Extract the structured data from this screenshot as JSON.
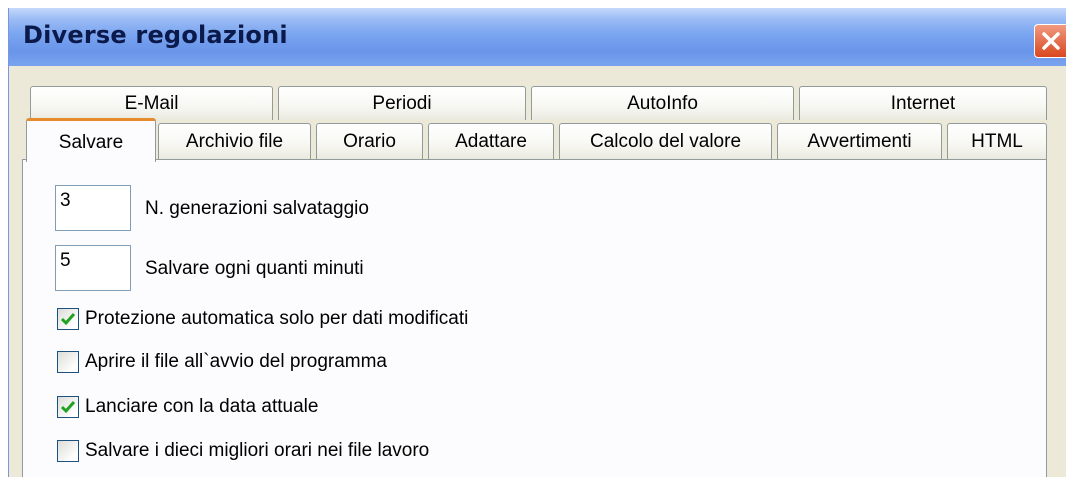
{
  "window": {
    "title": "Diverse regolazioni"
  },
  "tabs": {
    "row1": [
      {
        "id": "email",
        "label": "E-Mail"
      },
      {
        "id": "periodi",
        "label": "Periodi"
      },
      {
        "id": "autoinfo",
        "label": "AutoInfo"
      },
      {
        "id": "internet",
        "label": "Internet"
      }
    ],
    "row2": [
      {
        "id": "salvare",
        "label": "Salvare",
        "active": true
      },
      {
        "id": "archivio-file",
        "label": "Archivio file"
      },
      {
        "id": "orario",
        "label": "Orario"
      },
      {
        "id": "adattare",
        "label": "Adattare"
      },
      {
        "id": "calcolo-del-valore",
        "label": "Calcolo del valore"
      },
      {
        "id": "avvertimenti",
        "label": "Avvertimenti"
      },
      {
        "id": "html",
        "label": "HTML"
      }
    ]
  },
  "settings": {
    "generations": {
      "value": "3",
      "label": "N. generazioni salvataggio"
    },
    "minutes": {
      "value": "5",
      "label": "Salvare ogni quanti minuti"
    },
    "checkboxes": [
      {
        "label": "Protezione automatica solo per dati modificati",
        "checked": true
      },
      {
        "label": "Aprire il file all`avvio del programma",
        "checked": false
      },
      {
        "label": "Lanciare con la data attuale",
        "checked": true
      },
      {
        "label": "Salvare i dieci migliori orari nei file lavoro",
        "checked": false
      }
    ]
  },
  "colors": {
    "active_tab_accent": "#e68b2c",
    "close_button": "#d9471f",
    "checkmark": "#21a121"
  },
  "icons": {
    "close": "close-icon",
    "check": "checkmark-icon"
  }
}
